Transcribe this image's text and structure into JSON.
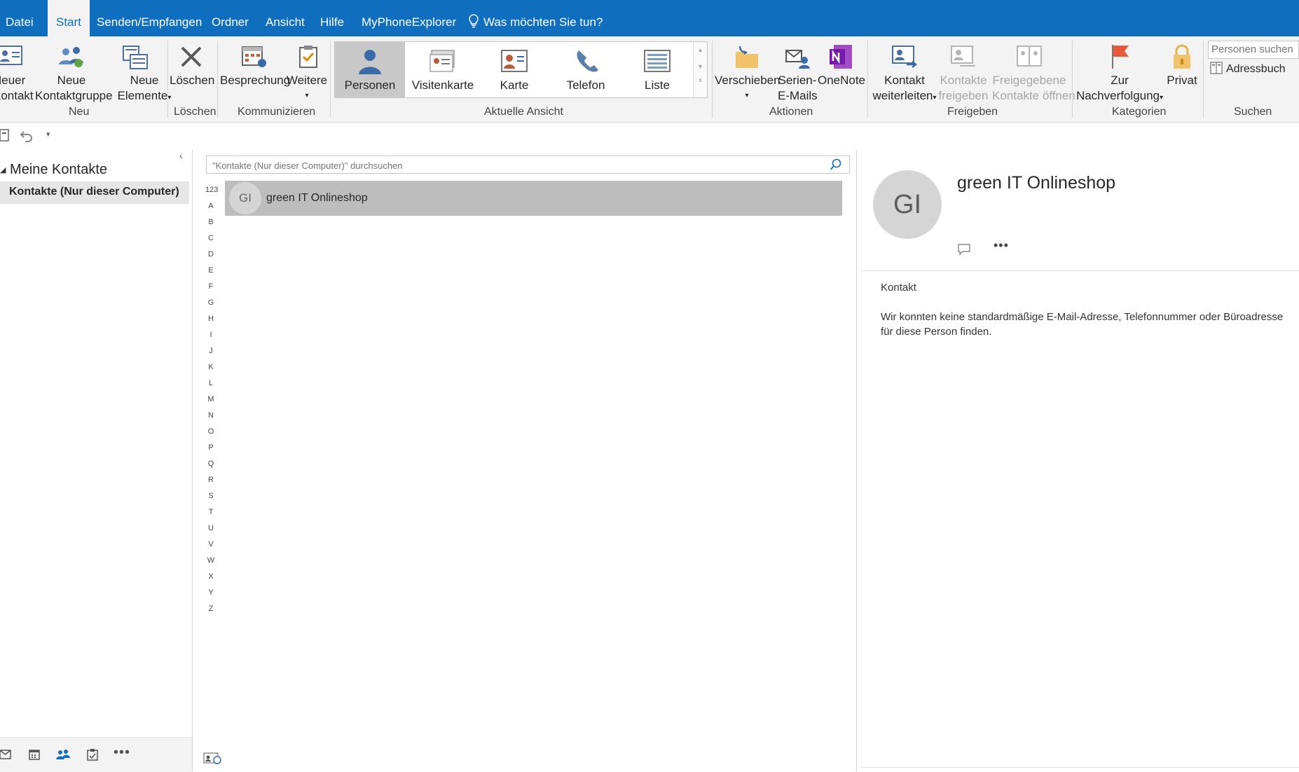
{
  "menu": {
    "tabs": [
      "Datei",
      "Start",
      "Senden/Empfangen",
      "Ordner",
      "Ansicht",
      "Hilfe",
      "MyPhoneExplorer"
    ],
    "active": "Start",
    "tell_me": "Was möchten Sie tun?"
  },
  "ribbon": {
    "neu": {
      "label": "Neu",
      "neuer_kontakt": [
        "Neuer",
        "Kontakt"
      ],
      "neue_kontaktgruppe": [
        "Neue",
        "Kontaktgruppe"
      ],
      "neue_elemente": [
        "Neue",
        "Elemente"
      ]
    },
    "loeschen": {
      "label": "Löschen",
      "button": "Löschen"
    },
    "kommunizieren": {
      "label": "Kommunizieren",
      "besprechung": "Besprechung",
      "weitere": "Weitere"
    },
    "aktuelle_ansicht": {
      "label": "Aktuelle Ansicht",
      "views": [
        "Personen",
        "Visitenkarte",
        "Karte",
        "Telefon",
        "Liste"
      ],
      "selected": "Personen"
    },
    "aktionen": {
      "label": "Aktionen",
      "verschieben": "Verschieben",
      "serien_emails": [
        "Serien-",
        "E-Mails"
      ],
      "onenote": "OneNote"
    },
    "freigeben": {
      "label": "Freigeben",
      "kontakt_weiterleiten": [
        "Kontakt",
        "weiterleiten"
      ],
      "kontakte_freigeben": [
        "Kontakte",
        "freigeben"
      ],
      "freigegebene_kontakte": [
        "Freigegebene",
        "Kontakte öffnen"
      ]
    },
    "kategorien": {
      "label": "Kategorien",
      "zur_nachverfolgung": [
        "Zur",
        "Nachverfolgung"
      ],
      "privat": "Privat"
    },
    "suchen": {
      "label": "Suchen",
      "placeholder": "Personen suchen",
      "adressbuch": "Adressbuch"
    }
  },
  "folders": {
    "header": "Meine Kontakte",
    "items": [
      "Kontakte (Nur dieser Computer)"
    ]
  },
  "list": {
    "search_placeholder": "\"Kontakte (Nur dieser Computer)\" durchsuchen",
    "alphabet": [
      "123",
      "A",
      "B",
      "C",
      "D",
      "E",
      "F",
      "G",
      "H",
      "I",
      "J",
      "K",
      "L",
      "M",
      "N",
      "O",
      "P",
      "Q",
      "R",
      "S",
      "T",
      "U",
      "V",
      "W",
      "X",
      "Y",
      "Z"
    ],
    "contacts": [
      {
        "initials": "GI",
        "name": "green IT Onlineshop"
      }
    ]
  },
  "detail": {
    "initials": "GI",
    "name": "green IT Onlineshop",
    "section": "Kontakt",
    "message_line1": "Wir konnten keine standardmäßige E-Mail-Adresse, Telefonnummer oder Büroadresse",
    "message_line2": "für diese Person finden."
  },
  "colors": {
    "accent": "#106ebe",
    "ribbon_bg": "#f3f3f3",
    "selection": "#bdbdbd"
  }
}
